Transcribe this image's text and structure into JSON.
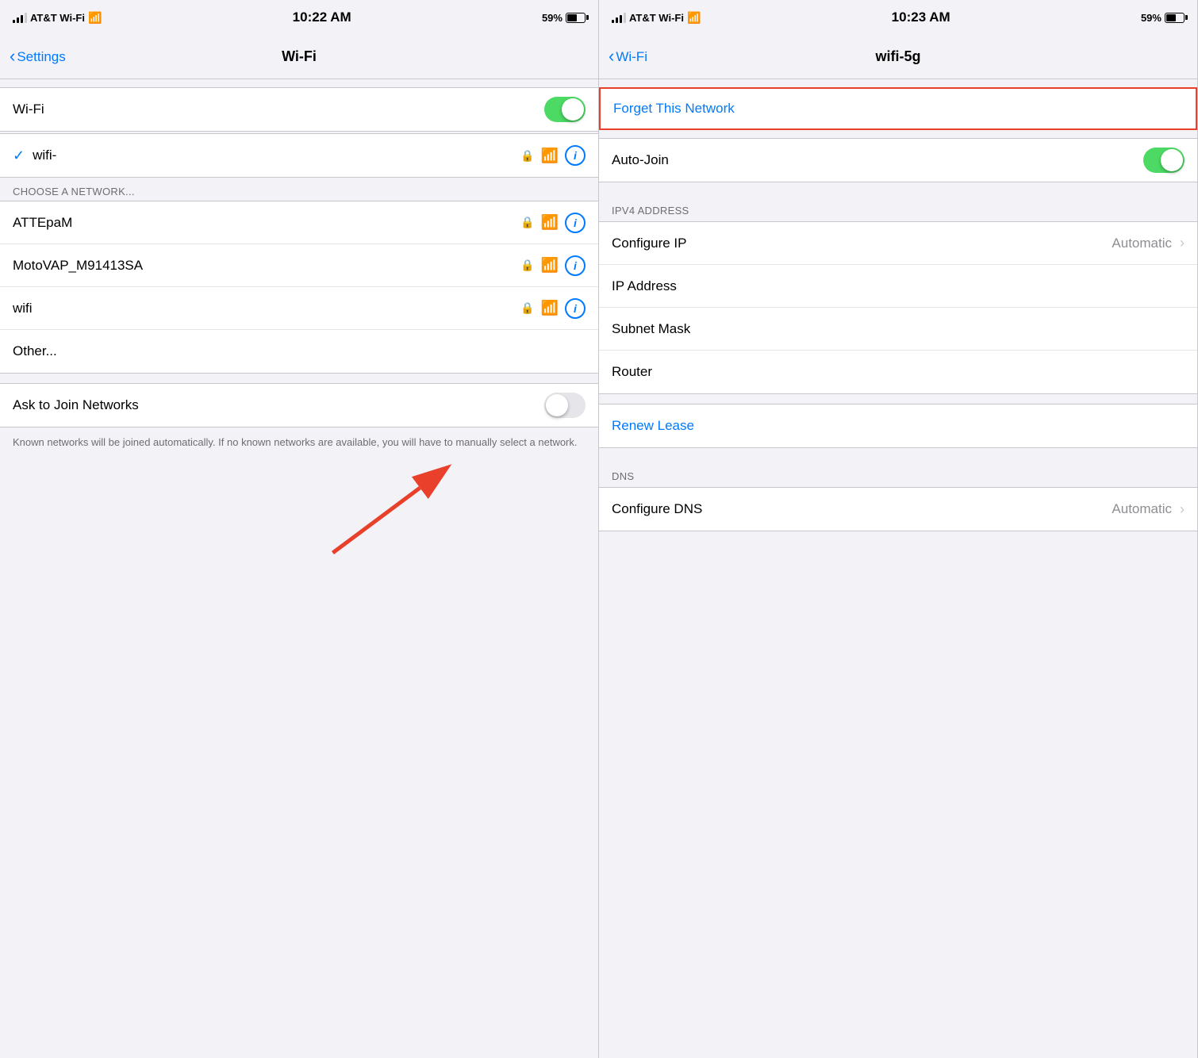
{
  "left": {
    "status": {
      "carrier": "AT&T Wi-Fi",
      "time": "10:22 AM",
      "battery": "59%"
    },
    "nav": {
      "back_label": "Settings",
      "title": "Wi-Fi"
    },
    "wifi_toggle_label": "Wi-Fi",
    "connected_network": "wifi-",
    "choose_network_label": "CHOOSE A NETWORK...",
    "networks": [
      {
        "name": "ATTEpaM"
      },
      {
        "name": "MotoVAP_M91413SA"
      },
      {
        "name": "wifi"
      },
      {
        "name": "Other..."
      }
    ],
    "ask_to_join_label": "Ask to Join Networks",
    "ask_to_join_helper": "Known networks will be joined automatically. If no known networks are available, you will have to manually select a network."
  },
  "right": {
    "status": {
      "carrier": "AT&T Wi-Fi",
      "time": "10:23 AM",
      "battery": "59%"
    },
    "nav": {
      "back_label": "Wi-Fi",
      "title": "wifi-5g"
    },
    "forget_btn_label": "Forget This Network",
    "auto_join_label": "Auto-Join",
    "ipv4_section_label": "IPV4 ADDRESS",
    "configure_ip_label": "Configure IP",
    "configure_ip_value": "Automatic",
    "ip_address_label": "IP Address",
    "subnet_mask_label": "Subnet Mask",
    "router_label": "Router",
    "renew_lease_label": "Renew Lease",
    "dns_section_label": "DNS",
    "configure_dns_label": "Configure DNS",
    "configure_dns_value": "Automatic"
  }
}
